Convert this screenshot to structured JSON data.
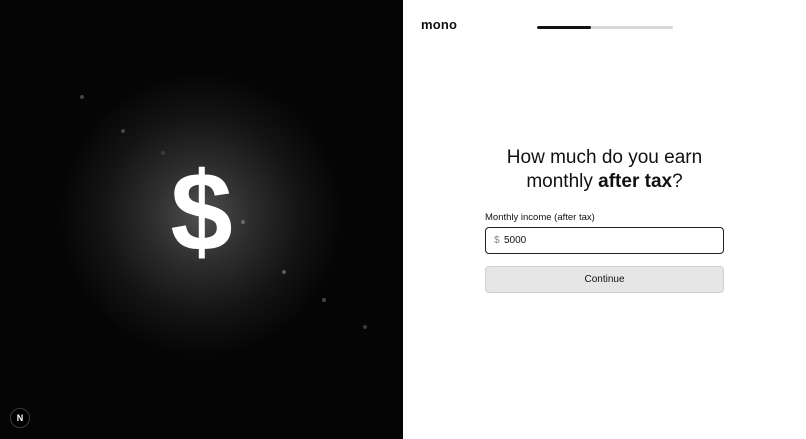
{
  "hero": {
    "symbol": "$",
    "badge_letter": "N"
  },
  "header": {
    "logo": "mono",
    "progress": 0.4
  },
  "question": {
    "line1": "How much do you earn",
    "line2_prefix": "monthly ",
    "line2_bold": "after tax",
    "line2_suffix": "?"
  },
  "income_field": {
    "label": "Monthly income (after tax)",
    "currency_prefix": "$",
    "value": "5000"
  },
  "actions": {
    "continue_label": "Continue"
  }
}
